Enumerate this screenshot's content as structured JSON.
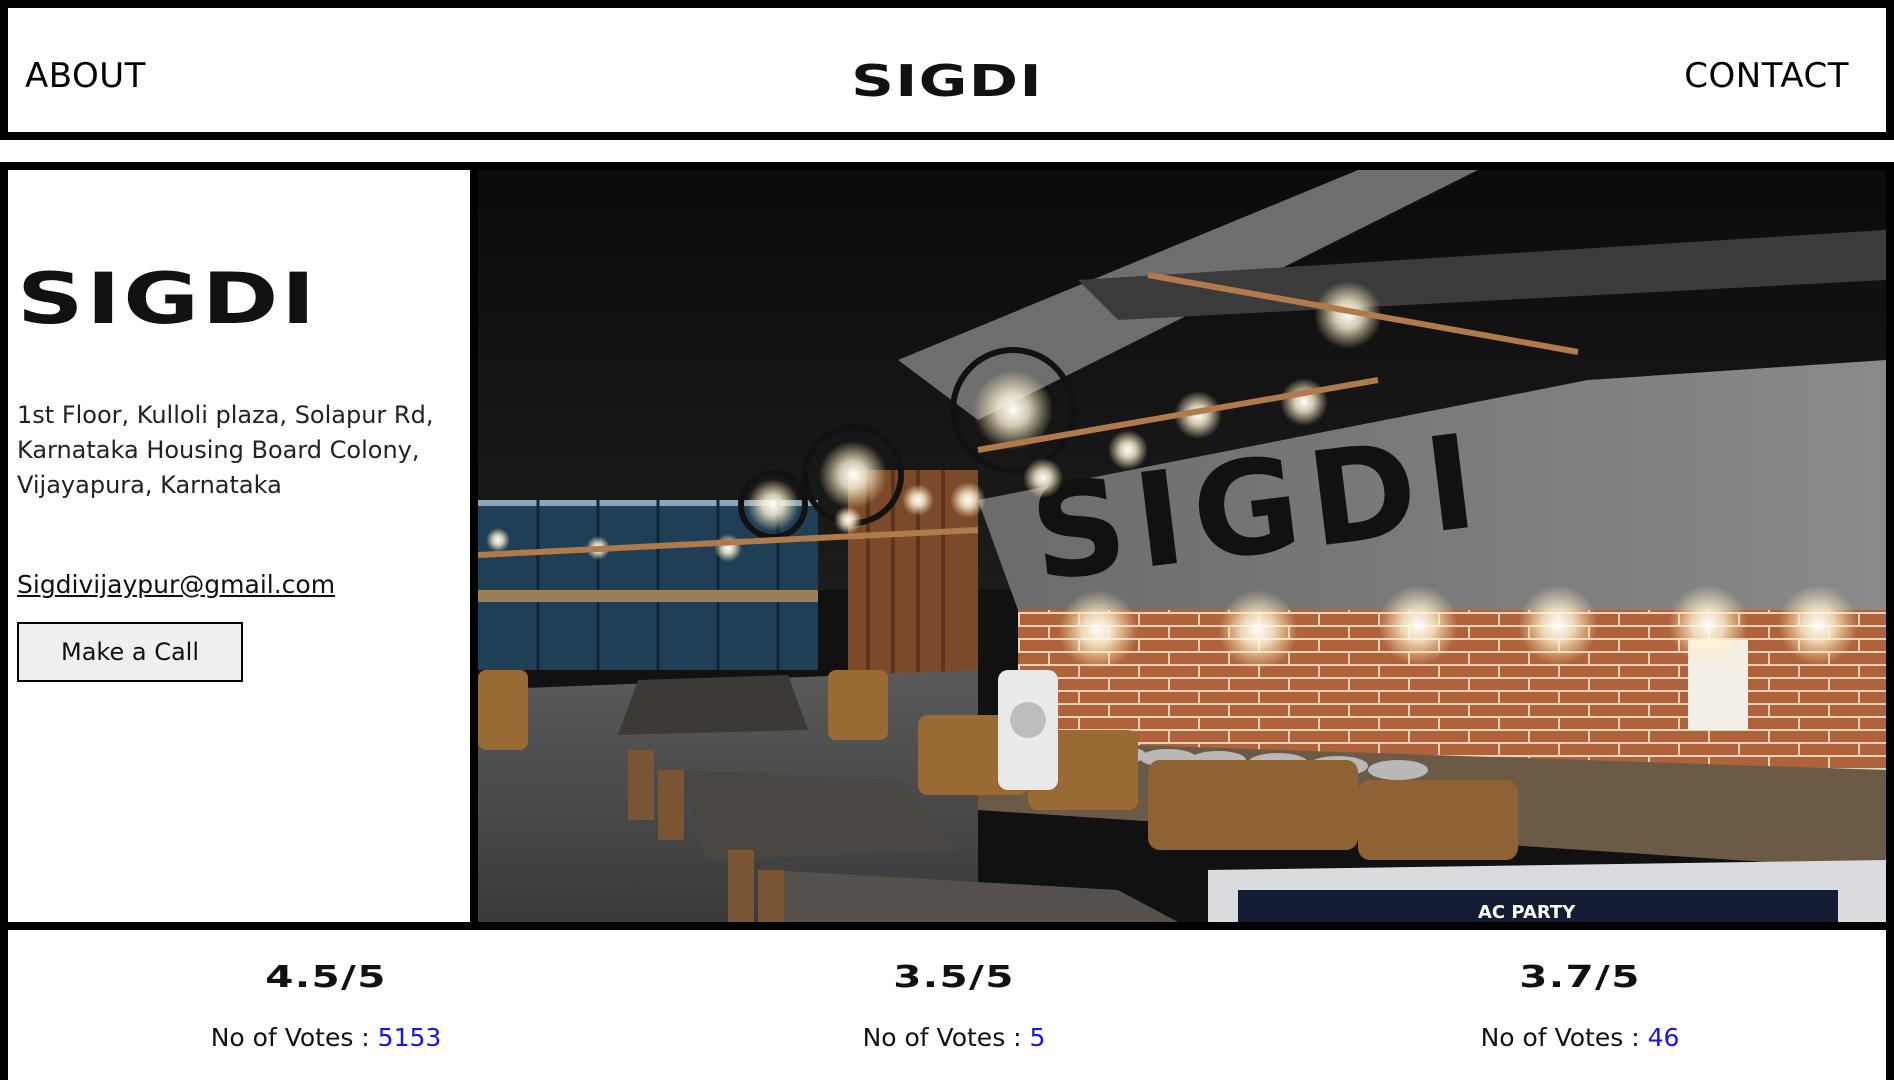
{
  "header": {
    "about": "ABOUT",
    "logo": "SIGDI",
    "contact": "CONTACT"
  },
  "restaurant": {
    "name": "SIGDI",
    "address_lines": [
      "1st Floor, Kulloli plaza, Solapur Rd,",
      "Karnataka Housing Board Colony,",
      "Vijayapura, Karnataka"
    ],
    "email": "Sigdivijaypur@gmail.com",
    "call_label": "Make a Call"
  },
  "photo": {
    "sign_text": "SIGDI",
    "banner_text": "AC PARTY"
  },
  "ratings": [
    {
      "score": "4.5/5",
      "votes_label": "No of Votes : ",
      "votes": "5153"
    },
    {
      "score": "3.5/5",
      "votes_label": "No of Votes : ",
      "votes": "5"
    },
    {
      "score": "3.7/5",
      "votes_label": "No of Votes : ",
      "votes": "46"
    }
  ],
  "colors": {
    "border": "#000000",
    "vote_count": "#1515e6",
    "button_bg": "#efefef"
  }
}
